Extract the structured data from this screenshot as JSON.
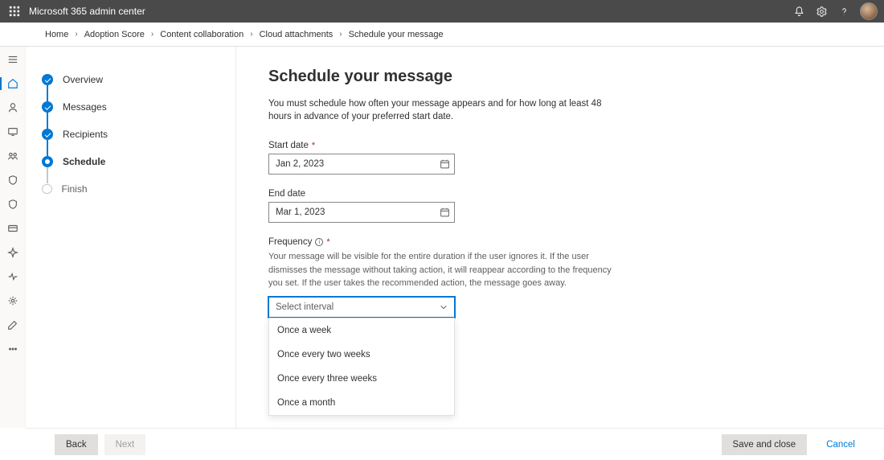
{
  "topbar": {
    "title": "Microsoft 365 admin center"
  },
  "breadcrumb": [
    "Home",
    "Adoption Score",
    "Content collaboration",
    "Cloud attachments",
    "Schedule your message"
  ],
  "steps": [
    {
      "label": "Overview",
      "state": "done"
    },
    {
      "label": "Messages",
      "state": "done"
    },
    {
      "label": "Recipients",
      "state": "done"
    },
    {
      "label": "Schedule",
      "state": "current"
    },
    {
      "label": "Finish",
      "state": "pending"
    }
  ],
  "page": {
    "title": "Schedule your message",
    "description": "You must schedule how often your message appears and for how long at least 48 hours in advance of your preferred start date."
  },
  "fields": {
    "start_date": {
      "label": "Start date",
      "required": true,
      "value": "Jan 2, 2023"
    },
    "end_date": {
      "label": "End date",
      "required": false,
      "value": "Mar 1, 2023"
    },
    "frequency": {
      "label": "Frequency",
      "required": true,
      "help": "Your message will be visible for the entire duration if the user ignores it. If the user dismisses the message without taking action, it will reappear according to the frequency you set. If the user takes the recommended action, the message goes away.",
      "placeholder": "Select interval",
      "options": [
        "Once a week",
        "Once every two weeks",
        "Once every three weeks",
        "Once a month"
      ]
    }
  },
  "footer": {
    "back": "Back",
    "next": "Next",
    "save": "Save and close",
    "cancel": "Cancel"
  }
}
